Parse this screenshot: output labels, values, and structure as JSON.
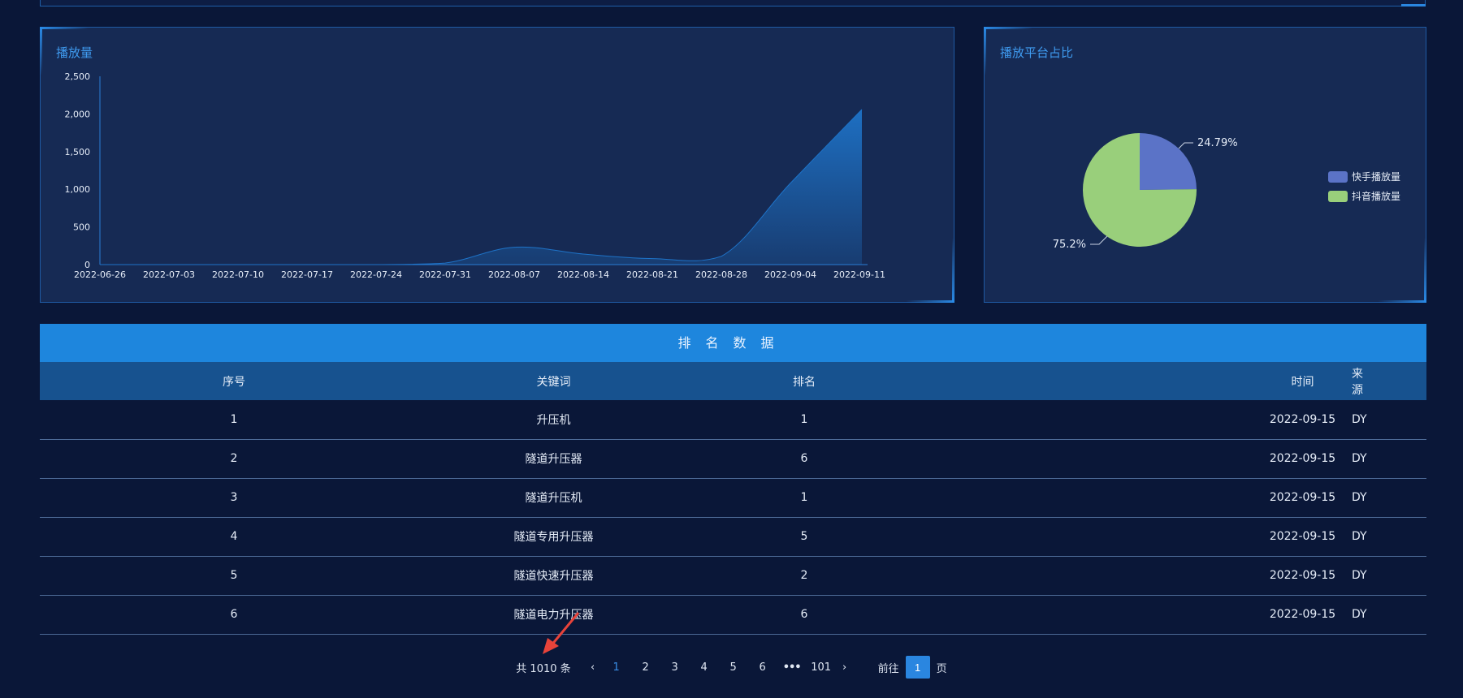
{
  "chart_panel": {
    "title": "播放量"
  },
  "pie_panel": {
    "title": "播放平台占比"
  },
  "chart_data": [
    {
      "type": "area",
      "title": "播放量",
      "x": [
        "2022-06-26",
        "2022-07-03",
        "2022-07-10",
        "2022-07-17",
        "2022-07-24",
        "2022-07-31",
        "2022-08-07",
        "2022-08-14",
        "2022-08-21",
        "2022-08-28",
        "2022-09-04",
        "2022-09-11"
      ],
      "values": [
        0,
        0,
        0,
        0,
        0,
        20,
        230,
        140,
        80,
        110,
        1080,
        2060
      ],
      "ylim": [
        0,
        2500
      ],
      "yticks": [
        0,
        500,
        1000,
        1500,
        2000,
        2500
      ],
      "ytick_labels": [
        "0",
        "500",
        "1,000",
        "1,500",
        "2,000",
        "2,500"
      ],
      "color": "#1e73c8"
    },
    {
      "type": "pie",
      "labels": [
        "快手播放量",
        "抖音播放量"
      ],
      "values": [
        24.79,
        75.2
      ],
      "value_labels": [
        "24.79%",
        "75.2%"
      ],
      "colors": [
        "#5b73c7",
        "#99cf7b"
      ],
      "legend": "right"
    }
  ],
  "table": {
    "title": "排名数据",
    "columns": [
      "序号",
      "关键词",
      "排名",
      "来源",
      "时间"
    ],
    "rows": [
      [
        "1",
        "升压机",
        "1",
        "DY",
        "2022-09-15"
      ],
      [
        "2",
        "隧道升压器",
        "6",
        "DY",
        "2022-09-15"
      ],
      [
        "3",
        "隧道升压机",
        "1",
        "DY",
        "2022-09-15"
      ],
      [
        "4",
        "隧道专用升压器",
        "5",
        "DY",
        "2022-09-15"
      ],
      [
        "5",
        "隧道快速升压器",
        "2",
        "DY",
        "2022-09-15"
      ],
      [
        "6",
        "隧道电力升压器",
        "6",
        "DY",
        "2022-09-15"
      ]
    ]
  },
  "pager": {
    "total": "共 1010 条",
    "pages": [
      "1",
      "2",
      "3",
      "4",
      "5",
      "6"
    ],
    "more": "•••",
    "last": "101",
    "current": "1",
    "goto_label": "前往",
    "goto_value": "1",
    "page_suffix": "页",
    "prev_icon": "chevron-left-icon",
    "next_icon": "chevron-right-icon"
  },
  "colors": {
    "accent": "#1e86dd",
    "background": "#0a1738",
    "panel": "#162a54",
    "annotation_arrow": "#e8433a"
  }
}
